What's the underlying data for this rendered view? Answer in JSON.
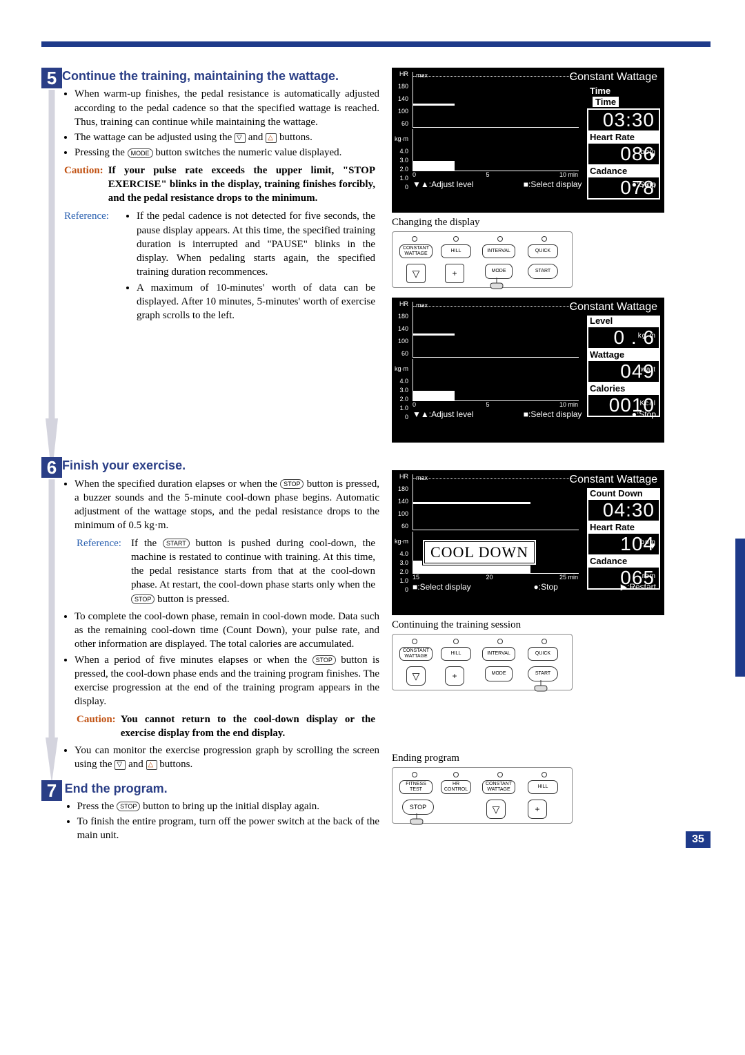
{
  "page_number": "35",
  "steps": {
    "s5": {
      "num": "5",
      "title": "Continue the training, maintaining the wattage.",
      "b1": "When warm-up finishes, the pedal resistance is automatically adjusted according to the pedal cadence so that the specified wattage is reached. Thus, training can continue while maintaining the wattage.",
      "b2a": "The wattage can be adjusted using the ",
      "b2b": " and ",
      "b2c": " buttons.",
      "b3a": "Pressing the ",
      "b3b": " button switches the numeric value displayed.",
      "caution_label": "Caution:",
      "caution": "If your pulse rate exceeds the upper limit, \"STOP EXERCISE\" blinks in the display, training finishes forcibly, and the pedal resistance drops to the minimum.",
      "ref_label": "Reference:",
      "ref1": "If the pedal cadence is not detected for five seconds, the pause display appears. At this time, the specified training duration is interrupted and \"PAUSE\" blinks in the display. When pedaling starts again, the specified training duration recommences.",
      "ref2": "A maximum of 10-minutes' worth of data can be displayed. After 10 minutes, 5-minutes' worth of exercise graph scrolls to the left."
    },
    "s6": {
      "num": "6",
      "title": "Finish your exercise.",
      "b1a": "When the specified duration elapses or when the ",
      "b1b": " button is pressed, a buzzer sounds and the 5-minute cool-down phase begins. Automatic adjustment of the wattage stops, and the pedal resistance drops to the minimum of 0.5 kg·m.",
      "ref_label": "Reference:",
      "refa": "If the ",
      "refb": " button is pushed during cool-down, the machine is restated to continue with training. At this time, the pedal resistance starts from that at the cool-down phase. At restart, the cool-down phase starts only when the ",
      "refc": " button is pressed.",
      "b2": "To complete the cool-down phase, remain in cool-down mode. Data such as the remaining cool-down time (Count Down), your pulse rate, and other information are displayed. The total calories are accumulated.",
      "b3a": "When a period of five minutes elapses or when the ",
      "b3b": " button is pressed, the cool-down phase ends and the training program finishes. The exercise progression at the end of the training program appears in the display.",
      "caution_label": "Caution:",
      "caution": "You cannot return to the cool-down display or the exercise display from the end display.",
      "b4a": "You can monitor the exercise progression graph by scrolling the screen using the ",
      "b4b": " and ",
      "b4c": " buttons."
    },
    "s7": {
      "num": "7",
      "title": "End the program.",
      "b1a": "Press the ",
      "b1b": " button to bring up the initial display again.",
      "b2": "To finish the entire program, turn off the power switch at the back of the main unit."
    }
  },
  "btn": {
    "mode": "MODE",
    "stop": "STOP",
    "start": "START"
  },
  "lcd1": {
    "title": "Constant Wattage",
    "hr_ticks": [
      "HR",
      "180",
      "140",
      "100",
      "60"
    ],
    "kg_ticks": [
      "kg·m",
      "4.0",
      "3.0",
      "2.0",
      "1.0",
      "0"
    ],
    "x": [
      "0",
      "5",
      "10 min"
    ],
    "max": "max",
    "m1_label": "Time",
    "m1_val": "03:30",
    "m2_label": "Heart Rate",
    "m2_val": "086",
    "m2_unit": "bpm",
    "m3_label": "Cadance",
    "m3_val": "078",
    "m3_unit": "rpm",
    "foot_a": ":Adjust level",
    "foot_b": ":Select display",
    "foot_c": ":Stop"
  },
  "caption1": "Changing the display",
  "panel1": {
    "b1": "CONSTANT WATTAGE",
    "b2": "HILL",
    "b3": "INTERVAL",
    "b4": "QUICK",
    "b5": "MODE",
    "b6": "START",
    "minus": "−",
    "plus": "+"
  },
  "lcd2": {
    "title": "Constant Wattage",
    "m1_label": "Level",
    "m1_val": "0 . 6",
    "m1_unit": "kg·m",
    "m2_label": "Wattage",
    "m2_val": "049",
    "m2_unit": "watt",
    "m3_label": "Calories",
    "m3_val": "0010",
    "m3_unit": "Kcal",
    "x": [
      "0",
      "5",
      "10 min"
    ],
    "foot_a": ":Adjust level",
    "foot_b": ":Select display",
    "foot_c": ":Stop"
  },
  "lcd3": {
    "title": "Constant Wattage",
    "banner": "COOL DOWN",
    "m1_label": "Count Down",
    "m1_val": "04:30",
    "m2_label": "Heart Rate",
    "m2_val": "104",
    "m2_unit": "bpm",
    "m3_label": "Cadance",
    "m3_val": "065",
    "m3_unit": "rpm",
    "x": [
      "15",
      "20",
      "25 min"
    ],
    "foot_a": ":Select display",
    "foot_b": ":Stop",
    "foot_c": ":Restart"
  },
  "caption2": "Continuing the training session",
  "panel2": {
    "b1": "CONSTANT WATTAGE",
    "b2": "HILL",
    "b3": "INTERVAL",
    "b4": "QUICK",
    "b5": "MODE",
    "b6": "START",
    "minus": "−",
    "plus": "+"
  },
  "caption3": "Ending program",
  "panel3": {
    "b1": "FITNESS TEST",
    "b2": "HR CONTROL",
    "b3": "CONSTANT WATTAGE",
    "b4": "HILL",
    "b5": "STOP",
    "minus": "−",
    "plus": "+"
  }
}
